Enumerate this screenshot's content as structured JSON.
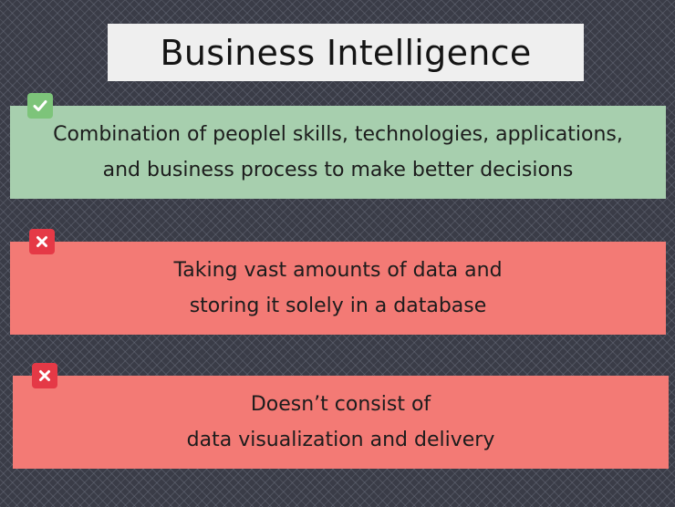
{
  "title": "Business Intelligence",
  "colors": {
    "background": "#3a3c47",
    "title_bg": "#efefef",
    "correct_card": "#a7cfae",
    "incorrect_card": "#f37a75",
    "check_badge": "#7dc47a",
    "cross_badge": "#e53946"
  },
  "cards": [
    {
      "status": "correct",
      "icon": "check-icon",
      "lines": [
        "Combination of peoplel skills, technologies, applications,",
        "and business process to make better decisions"
      ]
    },
    {
      "status": "incorrect",
      "icon": "cross-icon",
      "lines": [
        "Taking vast amounts of data and",
        "storing it solely in a database"
      ]
    },
    {
      "status": "incorrect",
      "icon": "cross-icon",
      "lines": [
        "Doesn’t consist of",
        "data visualization and delivery"
      ]
    }
  ]
}
